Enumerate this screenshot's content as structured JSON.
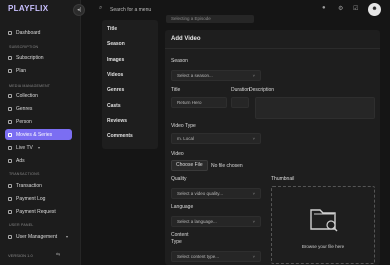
{
  "app": {
    "logo": "PLAYFLIX",
    "version": "VERSION 1.0",
    "collapse_icon": "◂|"
  },
  "sidebar": {
    "items": [
      {
        "label": "Dashboard",
        "icon": "home-icon",
        "active": false
      },
      {
        "label": "Subscription",
        "icon": "subscription-icon",
        "active": false
      },
      {
        "label": "Plan",
        "icon": "plan-icon",
        "active": false
      },
      {
        "label": "Collection",
        "icon": "collection-icon",
        "active": false
      },
      {
        "label": "Genres",
        "icon": "genres-icon",
        "active": false
      },
      {
        "label": "Person",
        "icon": "person-icon",
        "active": false
      },
      {
        "label": "Movies & Series",
        "icon": "movies-icon",
        "active": true
      },
      {
        "label": "Live TV",
        "icon": "tv-icon",
        "active": false,
        "has_chevron": true
      },
      {
        "label": "Ads",
        "icon": "ads-icon",
        "active": false
      },
      {
        "label": "Transaction",
        "icon": "transaction-icon",
        "active": false
      },
      {
        "label": "Payment Log",
        "icon": "payment-log-icon",
        "active": false
      },
      {
        "label": "Payment Request",
        "icon": "payment-request-icon",
        "active": false
      },
      {
        "label": "User Management",
        "icon": "user-management-icon",
        "active": false,
        "has_chevron": true
      }
    ],
    "sections": {
      "subscription": "SUBSCRIPTION",
      "media": "MEDIA MANAGEMENT",
      "transactions": "TRANSACTIONS",
      "users": "USER PANEL"
    },
    "chevron": "▾",
    "bottom_icon": "⇆"
  },
  "topbar": {
    "search_placeholder": "Search for a menu",
    "search_icon": "⌕",
    "icons": [
      "●",
      "⚙",
      "☑"
    ]
  },
  "tabs": [
    "Title",
    "Season",
    "Images",
    "Videos",
    "Genres",
    "Casts",
    "Reviews",
    "Comments"
  ],
  "previous_field": "Selecting a Episode",
  "form": {
    "title": "Add Video",
    "season_label": "Season",
    "season_placeholder": "Select a season...",
    "title_label": "Title",
    "title_value": "Return Hero",
    "duration_label": "Duration",
    "description_label": "Description",
    "video_type_label": "Video Type",
    "video_type_value": "m. Local",
    "video_label": "Video",
    "choose_file": "Choose File",
    "no_file": "No file chosen",
    "quality_label": "Quality",
    "quality_placeholder": "Select a video quality...",
    "thumbnail_label": "Thumbnail",
    "language_label": "Language",
    "language_placeholder": "Select a language...",
    "content_type_label_1": "Content",
    "content_type_label_2": "Type",
    "content_type_placeholder": "Select content type...",
    "caret": "˅",
    "upload_text": "Browse your file here"
  }
}
